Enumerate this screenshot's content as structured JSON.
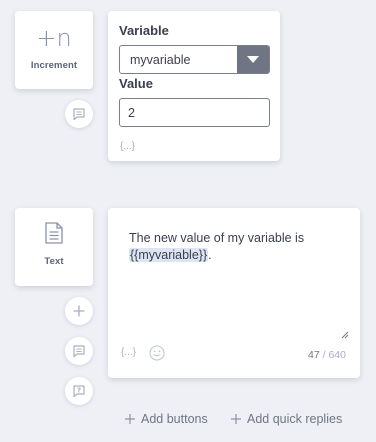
{
  "increment_block": {
    "icon": "plus-n-icon",
    "icon_text": "+n",
    "label": "Increment",
    "variable_label": "Variable",
    "variable_value": "myvariable",
    "value_label": "Value",
    "value_input": "2",
    "var_insert": "{...}"
  },
  "text_block": {
    "icon": "document-icon",
    "label": "Text",
    "message_prefix": "The new value of my variable is ",
    "message_variable": "{{myvariable}}",
    "message_suffix": ".",
    "var_insert": "{...}",
    "char_count": "47",
    "char_limit": "/ 640"
  },
  "actions": {
    "add_buttons": "Add buttons",
    "add_quick_replies": "Add quick replies"
  },
  "colors": {
    "background": "#eef0f5",
    "card": "#ffffff",
    "select_arrow_bg": "#6f7585",
    "variable_highlight": "#dde4f2"
  }
}
